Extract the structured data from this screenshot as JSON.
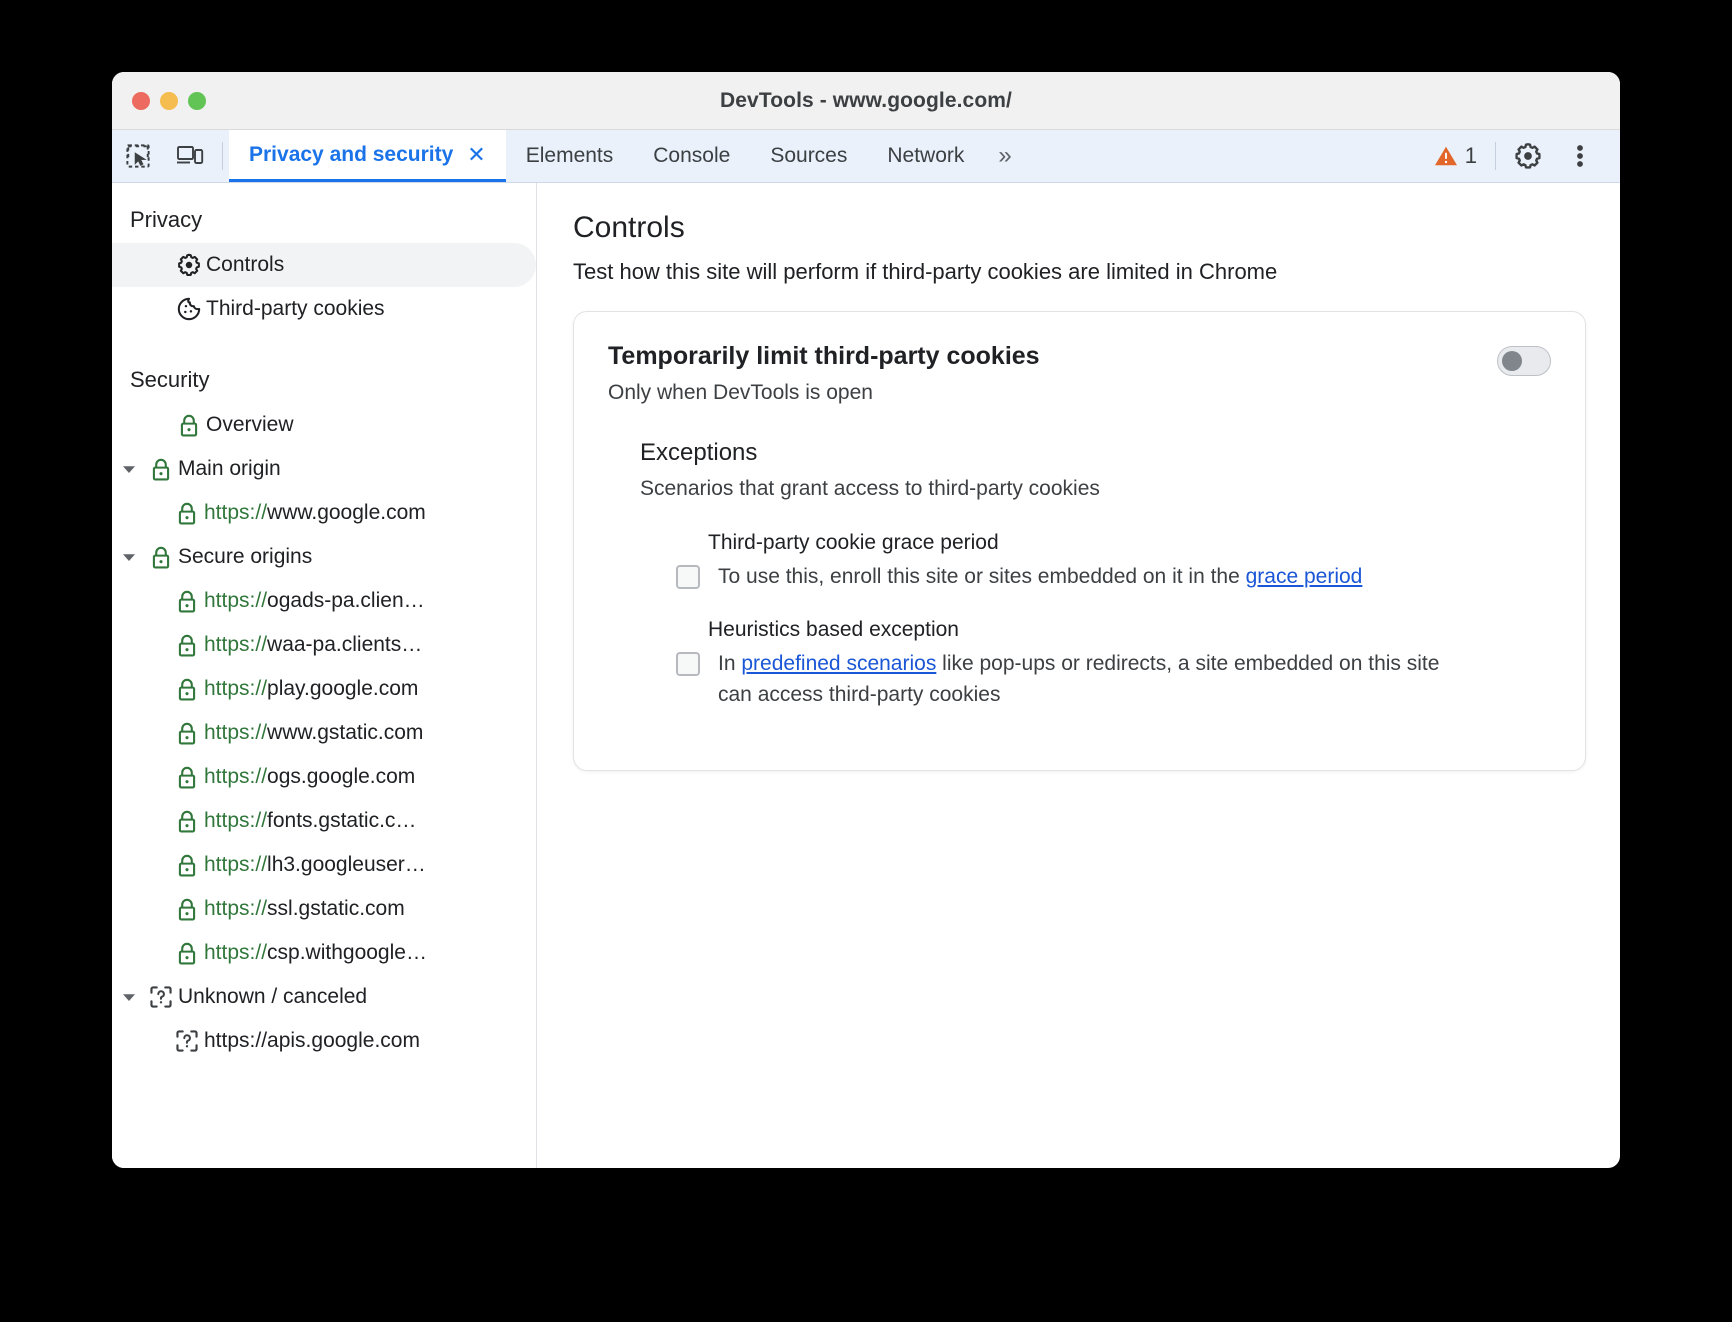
{
  "window": {
    "title": "DevTools - www.google.com/",
    "traffic_lights": [
      "close",
      "minimize",
      "maximize"
    ]
  },
  "tabbar": {
    "inspect_icon": "inspect-cursor-icon",
    "device_icon": "device-toolbar-icon",
    "tabs": [
      {
        "label": "Privacy and security",
        "active": true,
        "closable": true,
        "close_glyph": "✕"
      },
      {
        "label": "Elements",
        "active": false
      },
      {
        "label": "Console",
        "active": false
      },
      {
        "label": "Sources",
        "active": false
      },
      {
        "label": "Network",
        "active": false
      }
    ],
    "more_tabs_glyph": "»",
    "warning_count": "1",
    "warning_color": "#e2672a",
    "settings_icon": "gear-icon",
    "menu_icon": "kebab-menu-icon"
  },
  "sidebar": {
    "groups": [
      {
        "title": "Privacy",
        "items": [
          {
            "label": "Controls",
            "icon": "gear-icon",
            "indent": 1,
            "selected": true,
            "twisty": "none"
          },
          {
            "label": "Third-party cookies",
            "icon": "cookie-icon",
            "indent": 1,
            "selected": false,
            "twisty": "none"
          }
        ]
      },
      {
        "title": "Security",
        "items": [
          {
            "label": "Overview",
            "icon": "lock-icon",
            "indent": 1,
            "selected": false,
            "twisty": "none"
          },
          {
            "label": "Main origin",
            "icon": "lock-icon",
            "indent": 0,
            "selected": false,
            "twisty": "expanded"
          },
          {
            "scheme": "https://",
            "label": "www.google.com",
            "icon": "lock-icon",
            "indent": 2,
            "selected": false,
            "twisty": "none"
          },
          {
            "label": "Secure origins",
            "icon": "lock-icon",
            "indent": 0,
            "selected": false,
            "twisty": "expanded"
          },
          {
            "scheme": "https://",
            "label": "ogads-pa.clien…",
            "icon": "lock-icon",
            "indent": 2,
            "selected": false,
            "twisty": "none"
          },
          {
            "scheme": "https://",
            "label": "waa-pa.clients…",
            "icon": "lock-icon",
            "indent": 2,
            "selected": false,
            "twisty": "none"
          },
          {
            "scheme": "https://",
            "label": "play.google.com",
            "icon": "lock-icon",
            "indent": 2,
            "selected": false,
            "twisty": "none"
          },
          {
            "scheme": "https://",
            "label": "www.gstatic.com",
            "icon": "lock-icon",
            "indent": 2,
            "selected": false,
            "twisty": "none"
          },
          {
            "scheme": "https://",
            "label": "ogs.google.com",
            "icon": "lock-icon",
            "indent": 2,
            "selected": false,
            "twisty": "none"
          },
          {
            "scheme": "https://",
            "label": "fonts.gstatic.c…",
            "icon": "lock-icon",
            "indent": 2,
            "selected": false,
            "twisty": "none"
          },
          {
            "scheme": "https://",
            "label": "lh3.googleuser…",
            "icon": "lock-icon",
            "indent": 2,
            "selected": false,
            "twisty": "none"
          },
          {
            "scheme": "https://",
            "label": "ssl.gstatic.com",
            "icon": "lock-icon",
            "indent": 2,
            "selected": false,
            "twisty": "none"
          },
          {
            "scheme": "https://",
            "label": "csp.withgoogle…",
            "icon": "lock-icon",
            "indent": 2,
            "selected": false,
            "twisty": "none"
          },
          {
            "label": "Unknown / canceled",
            "icon": "unknown-icon",
            "indent": 0,
            "selected": false,
            "twisty": "expanded"
          },
          {
            "label": "https://apis.google.com",
            "icon": "unknown-icon",
            "indent": 2,
            "selected": false,
            "twisty": "none"
          }
        ]
      }
    ]
  },
  "main": {
    "title": "Controls",
    "subtitle": "Test how this site will perform if third-party cookies are limited in Chrome",
    "card": {
      "title": "Temporarily limit third-party cookies",
      "subtitle": "Only when DevTools is open",
      "toggle": {
        "name": "limit-third-party-cookies-toggle",
        "checked": false
      },
      "exceptions": {
        "title": "Exceptions",
        "subtitle": "Scenarios that grant access to third-party cookies",
        "items": [
          {
            "label": "Third-party cookie grace period",
            "checked": false,
            "desc_before": "To use this, enroll this site or sites embedded on it in the ",
            "link": "grace period",
            "desc_after": ""
          },
          {
            "label": "Heuristics based exception",
            "checked": false,
            "desc_before": "In ",
            "link": "predefined scenarios",
            "desc_after": " like pop-ups or redirects, a site embedded on this site can access third-party cookies"
          }
        ]
      }
    }
  },
  "colors": {
    "accent": "#1a73e8",
    "link": "#1a56d6",
    "secure_green": "#31773b",
    "warning_orange": "#e2672a",
    "tabbar_bg": "#eaf1fb"
  }
}
